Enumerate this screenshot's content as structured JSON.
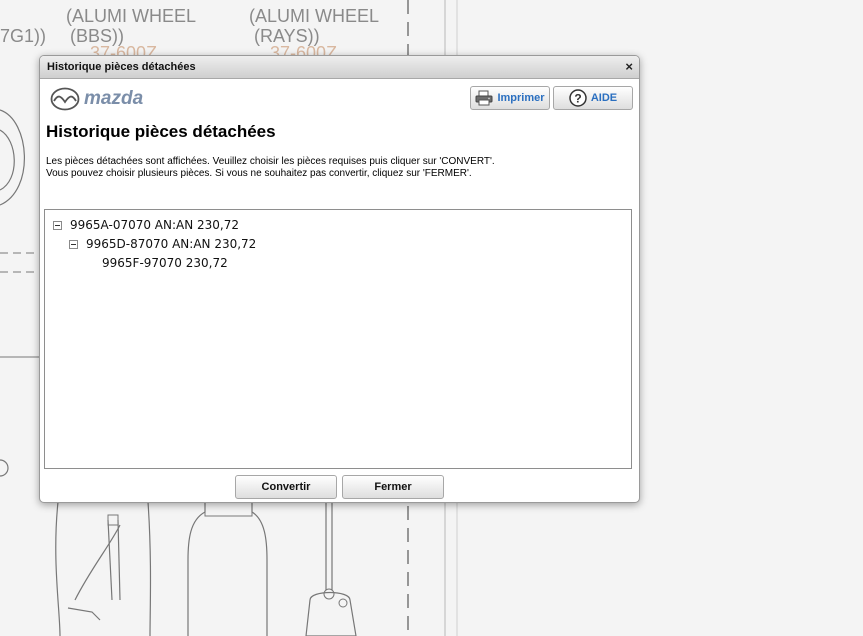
{
  "background": {
    "labels": [
      "(ALUMI WHEEL",
      "(BBS))",
      "(ALUMI WHEEL",
      "(RAYS))",
      "7G1))"
    ],
    "part_codes": [
      "37-600Z",
      "37-600Z"
    ]
  },
  "dialog": {
    "title": "Historique pièces détachées",
    "close_symbol": "×",
    "logo_text": "mazda",
    "print_label": "Imprimer",
    "help_label": "AIDE",
    "heading": "Historique pièces détachées",
    "info_line1": "Les pièces détachées sont affichées. Veuillez choisir les pièces requises puis cliquer sur 'CONVERT'.",
    "info_line2": "Vous pouvez choisir plusieurs pièces. Si vous ne souhaitez pas convertir, cliquez sur 'FERMER'.",
    "tree": [
      {
        "label": "9965A-07070 AN:AN 230,72",
        "expanded": true
      },
      {
        "label": "9965D-87070 AN:AN 230,72",
        "expanded": true
      },
      {
        "label": "9965F-97070 230,72",
        "expanded": false
      }
    ],
    "convert_label": "Convertir",
    "close_label": "Fermer"
  },
  "icons": [
    "close-icon",
    "printer-icon",
    "help-icon",
    "mazda-logo-icon",
    "collapse-icon"
  ]
}
